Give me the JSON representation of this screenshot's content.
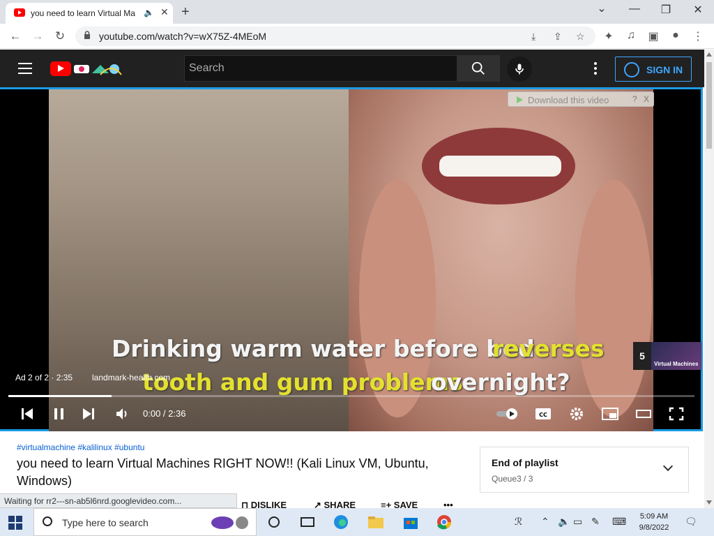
{
  "browser": {
    "tab_title": "you need to learn Virtual Ma",
    "url": "youtube.com/watch?v=wX75Z-4MEoM",
    "new_tab": "+",
    "tab_close": "✕",
    "win_minimize": "—",
    "win_restore": "❐",
    "win_close": "✕",
    "back": "←",
    "forward": "→",
    "reload": "↻",
    "install_icon": "⤓",
    "share_icon": "⇪",
    "star_icon": "☆"
  },
  "youtube_header": {
    "search_placeholder": "Search",
    "sign_in_label": "SIGN IN"
  },
  "player": {
    "download_bar_text": "Download this video",
    "download_help": "?",
    "download_close": "X",
    "caption_line1_white": "Drinking warm water before bed",
    "caption_line1_yellow": "reverses",
    "caption_line2_yellow": "tooth and gum problems",
    "caption_line2_white": "overnight?",
    "endcard_number": "5",
    "endcard_label": "Virtual Machines",
    "ad_info": "Ad 2 of 2 · 2:35",
    "ad_link": "landmark-health.com",
    "time": "0:00 / 2:36",
    "progress": 0.15
  },
  "video": {
    "hashtags": "#virtualmachine #kalilinux #ubuntu",
    "title": "you need to learn Virtual Machines RIGHT NOW!! (Kali Linux VM, Ubuntu, Windows)"
  },
  "playlist": {
    "title": "End of playlist",
    "subtitle": "Queue3 / 3"
  },
  "actions": {
    "dislike": "DISLIKE",
    "share": "SHARE",
    "save": "SAVE",
    "more": "•••"
  },
  "status_bar": "Waiting for rr2---sn-ab5l6nrd.googlevideo.com...",
  "taskbar": {
    "search_text": "Type here to search",
    "time": "5:09 AM",
    "date": "9/8/2022"
  }
}
